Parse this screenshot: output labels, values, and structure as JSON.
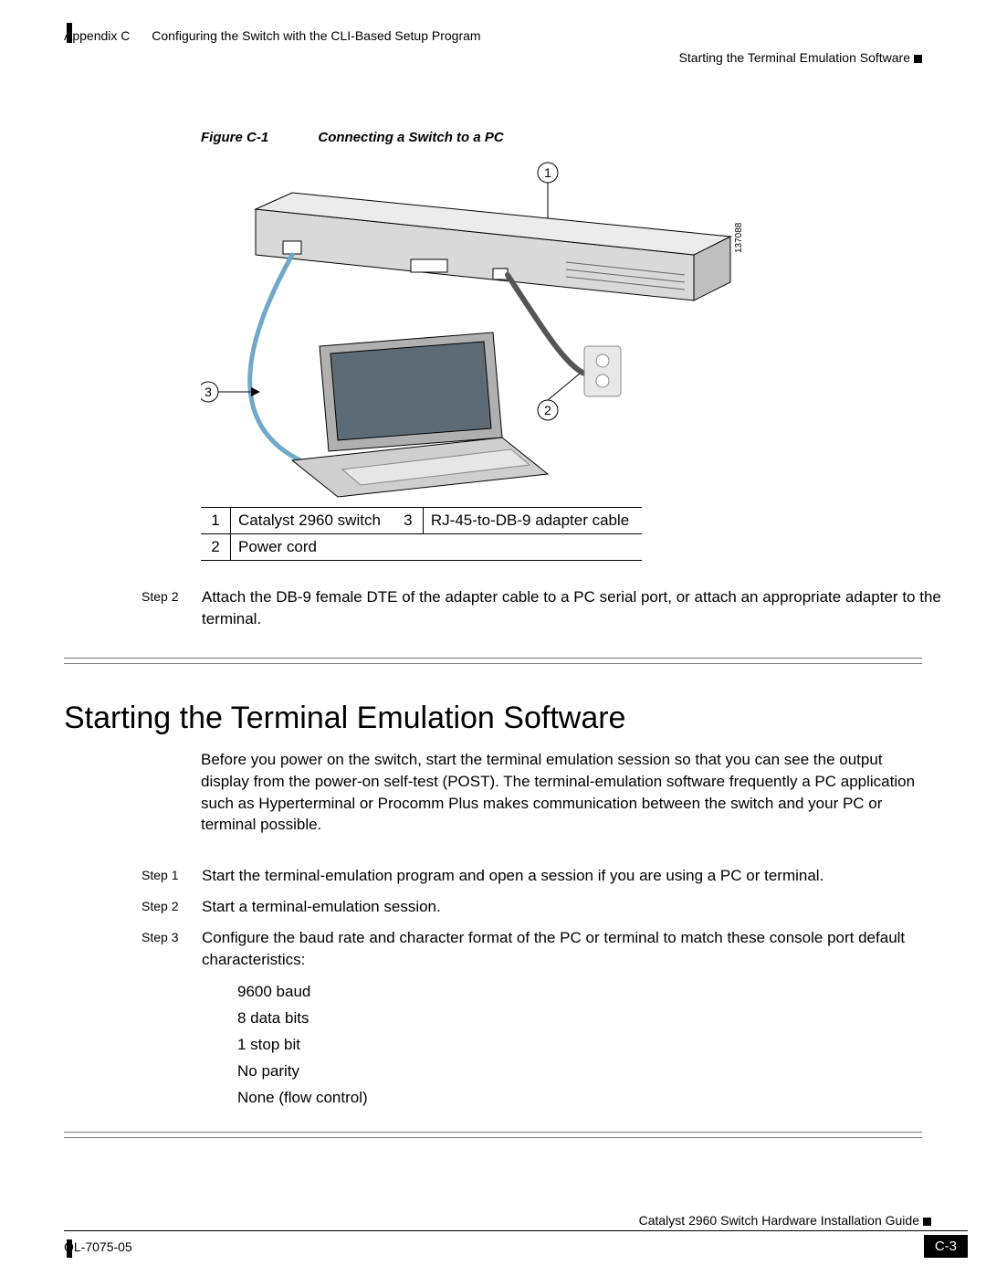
{
  "header": {
    "appendix": "Appendix C",
    "chapter": "Configuring the Switch with the CLI-Based Setup Program",
    "section": "Starting the Terminal Emulation Software"
  },
  "figure": {
    "num": "Figure C-1",
    "title": "Connecting a Switch to a PC",
    "image_id": "137088",
    "callouts": {
      "c1": "1",
      "c2": "2",
      "c3": "3"
    }
  },
  "legend": {
    "r1n": "1",
    "r1l": "Catalyst 2960 switch",
    "r2n": "2",
    "r2l": "Power cord",
    "r3n": "3",
    "r3l": "RJ-45-to-DB-9 adapter cable"
  },
  "step_above": {
    "num": "Step 2",
    "text": "Attach the DB-9 female DTE of the adapter cable to a PC serial port, or attach an appropriate adapter to the terminal."
  },
  "section_title": "Starting the Terminal Emulation Software",
  "intro": "Before you power on the switch, start the terminal emulation session so that you can see the output display from the power-on self-test (POST). The terminal-emulation software frequently a PC application such as Hyperterminal or Procomm Plus makes communication between the switch and your PC or terminal possible.",
  "steps": {
    "s1n": "Step 1",
    "s1t": "Start the terminal-emulation program and open a session if you are using a PC or terminal.",
    "s2n": "Step 2",
    "s2t": "Start a terminal-emulation session.",
    "s3n": "Step 3",
    "s3t": "Configure the baud rate and character format of the PC or terminal to match these console port default characteristics:"
  },
  "config": {
    "l1": "9600 baud",
    "l2": "8 data bits",
    "l3": "1 stop bit",
    "l4": "No parity",
    "l5": "None (flow control)"
  },
  "footer": {
    "guide": "Catalyst 2960 Switch Hardware Installation Guide",
    "doc": "OL-7075-05",
    "page": "C-3"
  }
}
